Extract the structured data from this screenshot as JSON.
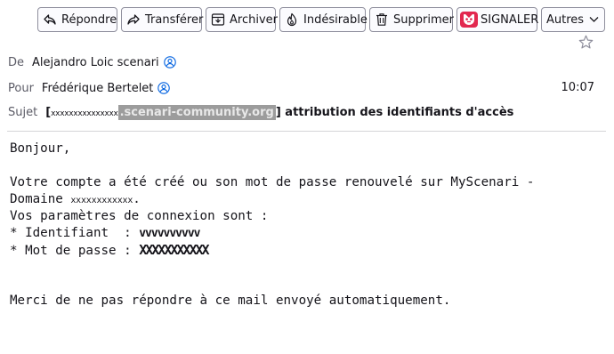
{
  "toolbar": {
    "reply_label": "Répondre",
    "forward_label": "Transférer",
    "archive_label": "Archiver",
    "junk_label": "Indésirable",
    "delete_label": "Supprimer",
    "report_label": "SIGNALER",
    "more_label": "Autres",
    "report_brand_color": "#e22850"
  },
  "header": {
    "from_label": "De",
    "from_value": "Alejandro Loic scenari",
    "to_label": "Pour",
    "to_value": "Frédérique Bertelet",
    "time": "10:07",
    "subject_label": "Sujet",
    "subject_bracket_open": "[",
    "subject_redacted": "xxxxxxxxxxxxxxx",
    "subject_domain": ".scenari-community.org",
    "subject_bracket_close": "]",
    "subject_text": " attribution des identifiants d'accès"
  },
  "body": {
    "greeting": "Bonjour,",
    "line1": "Votre compte a été créé ou son mot de passe renouvelé sur MyScenari -",
    "line2_prefix": "Domaine ",
    "line2_redacted": "xxxxxxxxxxxx",
    "line2_suffix": ".",
    "line3": "Vos paramètres de connexion sont :",
    "id_label": "* Identifiant  : ",
    "id_redacted": "vvvvvvvvvv",
    "pw_label": "* Mot de passe : ",
    "pw_redacted": "XXXXXXXXXXX",
    "closing": "Merci de ne pas répondre à ce mail envoyé automatiquement."
  },
  "icons": {
    "reply": "reply-icon",
    "forward": "forward-icon",
    "archive": "archive-icon",
    "junk": "junk-icon",
    "delete": "trash-icon",
    "report": "report-logo-icon",
    "more": "chevron-down-icon",
    "star": "star-icon",
    "contact": "contact-icon"
  }
}
